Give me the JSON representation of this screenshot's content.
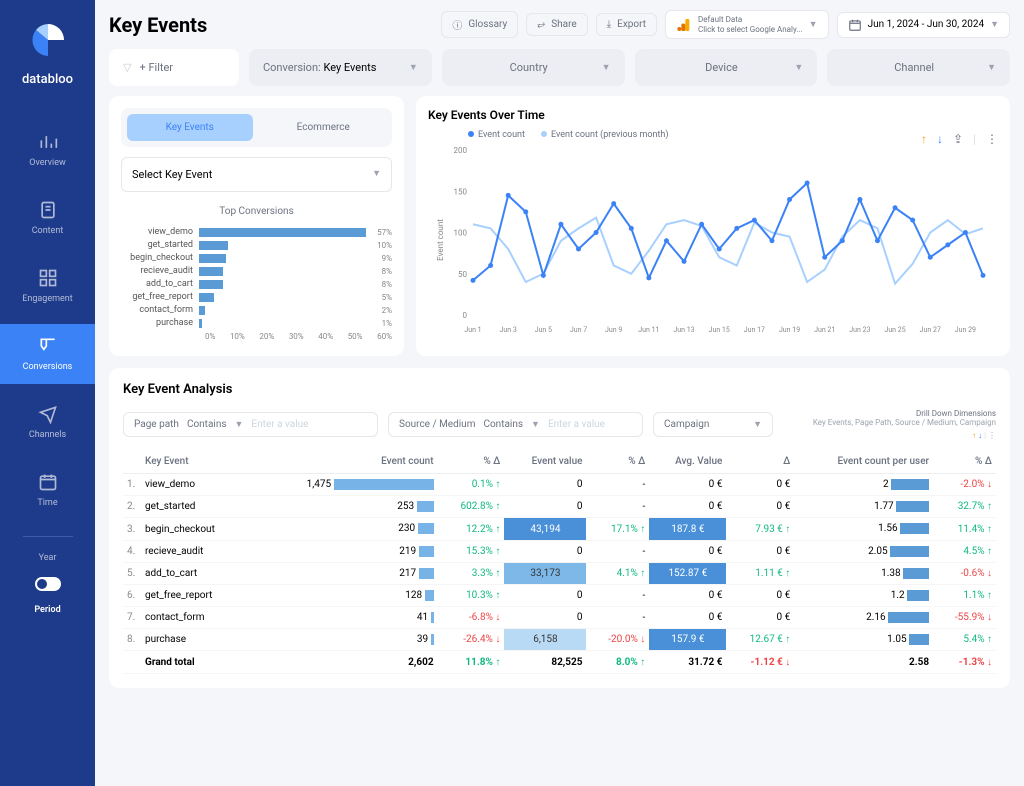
{
  "brand": "databloo",
  "page_title": "Key Events",
  "header": {
    "glossary": "Glossary",
    "share": "Share",
    "export": "Export",
    "data_source_label": "Default Data",
    "data_source_sub": "Click to select Google Analy...",
    "date_range": "Jun 1, 2024 - Jun 30, 2024"
  },
  "sidebar": {
    "items": [
      "Overview",
      "Content",
      "Engagement",
      "Conversions",
      "Channels",
      "Time"
    ],
    "year": "Year",
    "period": "Period"
  },
  "filters": {
    "add": "+ Filter",
    "conversion_lbl": "Conversion:",
    "conversion_val": "Key Events",
    "country": "Country",
    "device": "Device",
    "channel": "Channel"
  },
  "tabs": {
    "key_events": "Key Events",
    "ecommerce": "Ecommerce"
  },
  "select_event": "Select Key Event",
  "top_conv_title": "Top Conversions",
  "chart_data": {
    "type": "bar",
    "categories": [
      "view_demo",
      "get_started",
      "begin_checkout",
      "recieve_audit",
      "add_to_cart",
      "get_free_report",
      "contact_form",
      "purchase"
    ],
    "values": [
      57,
      10,
      9,
      8,
      8,
      5,
      2,
      1
    ],
    "xlabel": "%",
    "ylim": [
      0,
      60
    ],
    "x_ticks": [
      "0%",
      "10%",
      "20%",
      "30%",
      "40%",
      "50%",
      "60%"
    ]
  },
  "over_time": {
    "title": "Key Events Over Time",
    "y_label": "Event count",
    "legend": [
      "Event count",
      "Event count (previous month)"
    ],
    "y_ticks": [
      "200",
      "150",
      "100",
      "50",
      "0"
    ],
    "x_ticks": [
      "Jun 1",
      "Jun 3",
      "Jun 5",
      "Jun 7",
      "Jun 9",
      "Jun 11",
      "Jun 13",
      "Jun 15",
      "Jun 17",
      "Jun 19",
      "Jun 21",
      "Jun 23",
      "Jun 25",
      "Jun 27",
      "Jun 29"
    ],
    "series": [
      {
        "name": "current",
        "values": [
          42,
          60,
          145,
          125,
          48,
          110,
          80,
          100,
          135,
          105,
          45,
          90,
          65,
          110,
          80,
          105,
          115,
          90,
          140,
          160,
          70,
          90,
          140,
          90,
          130,
          115,
          70,
          85,
          100,
          48
        ]
      },
      {
        "name": "previous",
        "values": [
          110,
          105,
          80,
          40,
          50,
          90,
          105,
          118,
          60,
          50,
          78,
          110,
          115,
          108,
          70,
          60,
          112,
          100,
          95,
          40,
          55,
          95,
          115,
          105,
          38,
          62,
          100,
          115,
          98,
          105
        ]
      }
    ]
  },
  "analysis": {
    "title": "Key Event Analysis",
    "page_path": "Page path",
    "contains": "Contains",
    "placeholder": "Enter a value",
    "source": "Source / Medium",
    "campaign": "Campaign",
    "drill_title": "Drill Down Dimensions",
    "drill_sub": "Key Events, Page Path, Source / Medium, Campaign",
    "columns": [
      "",
      "Key Event",
      "Event count",
      "% Δ",
      "Event value",
      "% Δ",
      "Avg. Value",
      "Δ",
      "Event count per user",
      "% Δ"
    ],
    "rows": [
      {
        "i": "1.",
        "k": "view_demo",
        "ec": "1,475",
        "ecb": 100,
        "pd": "0.1% ↑",
        "pdc": "up",
        "ev": "0",
        "evh": "",
        "ep": "-",
        "av": "0 €",
        "avh": "",
        "ad": "0 €",
        "eu": "2",
        "eub": 38,
        "ed": "-2.0% ↓",
        "edc": "dn"
      },
      {
        "i": "2.",
        "k": "get_started",
        "ec": "253",
        "ecb": 17,
        "pd": "602.8% ↑",
        "pdc": "up",
        "ev": "0",
        "evh": "",
        "ep": "-",
        "av": "0 €",
        "avh": "",
        "ad": "0 €",
        "eu": "1.77",
        "eub": 33,
        "ed": "32.7% ↑",
        "edc": "up"
      },
      {
        "i": "3.",
        "k": "begin_checkout",
        "ec": "230",
        "ecb": 16,
        "pd": "12.2% ↑",
        "pdc": "up",
        "ev": "43,194",
        "evh": "dark",
        "ep": "17.1% ↑",
        "epc": "up",
        "av": "187.8 €",
        "avh": "dark",
        "ad": "7.93 € ↑",
        "adc": "up",
        "eu": "1.56",
        "eub": 29,
        "ed": "11.4% ↑",
        "edc": "up"
      },
      {
        "i": "4.",
        "k": "recieve_audit",
        "ec": "219",
        "ecb": 15,
        "pd": "15.3% ↑",
        "pdc": "up",
        "ev": "0",
        "evh": "",
        "ep": "-",
        "av": "0 €",
        "avh": "",
        "ad": "0 €",
        "eu": "2.05",
        "eub": 39,
        "ed": "4.5% ↑",
        "edc": "up"
      },
      {
        "i": "5.",
        "k": "add_to_cart",
        "ec": "217",
        "ecb": 15,
        "pd": "3.3% ↑",
        "pdc": "up",
        "ev": "33,173",
        "evh": "mid",
        "ep": "4.1% ↑",
        "epc": "up",
        "av": "152.87 €",
        "avh": "dark",
        "ad": "1.11 € ↑",
        "adc": "up",
        "eu": "1.38",
        "eub": 26,
        "ed": "-0.6% ↓",
        "edc": "dn"
      },
      {
        "i": "6.",
        "k": "get_free_report",
        "ec": "128",
        "ecb": 9,
        "pd": "10.3% ↑",
        "pdc": "up",
        "ev": "0",
        "evh": "",
        "ep": "-",
        "av": "0 €",
        "avh": "",
        "ad": "0 €",
        "eu": "1.2",
        "eub": 22,
        "ed": "1.1% ↑",
        "edc": "up"
      },
      {
        "i": "7.",
        "k": "contact_form",
        "ec": "41",
        "ecb": 3,
        "pd": "-6.8% ↓",
        "pdc": "dn",
        "ev": "0",
        "evh": "",
        "ep": "-",
        "av": "0 €",
        "avh": "",
        "ad": "0 €",
        "eu": "2.16",
        "eub": 41,
        "ed": "-55.9% ↓",
        "edc": "dn"
      },
      {
        "i": "8.",
        "k": "purchase",
        "ec": "39",
        "ecb": 3,
        "pd": "-26.4% ↓",
        "pdc": "dn",
        "ev": "6,158",
        "evh": "light",
        "ep": "-20.0% ↓",
        "epc": "dn",
        "av": "157.9 €",
        "avh": "dark",
        "ad": "12.67 € ↑",
        "adc": "up",
        "eu": "1.05",
        "eub": 20,
        "ed": "5.4% ↑",
        "edc": "up"
      }
    ],
    "grand": {
      "lbl": "Grand total",
      "ec": "2,602",
      "pd": "11.8% ↑",
      "ev": "82,525",
      "ep": "8.0% ↑",
      "av": "31.72 €",
      "ad": "-1.12 € ↓",
      "eu": "2.58",
      "ed": "-1.3% ↓"
    }
  }
}
